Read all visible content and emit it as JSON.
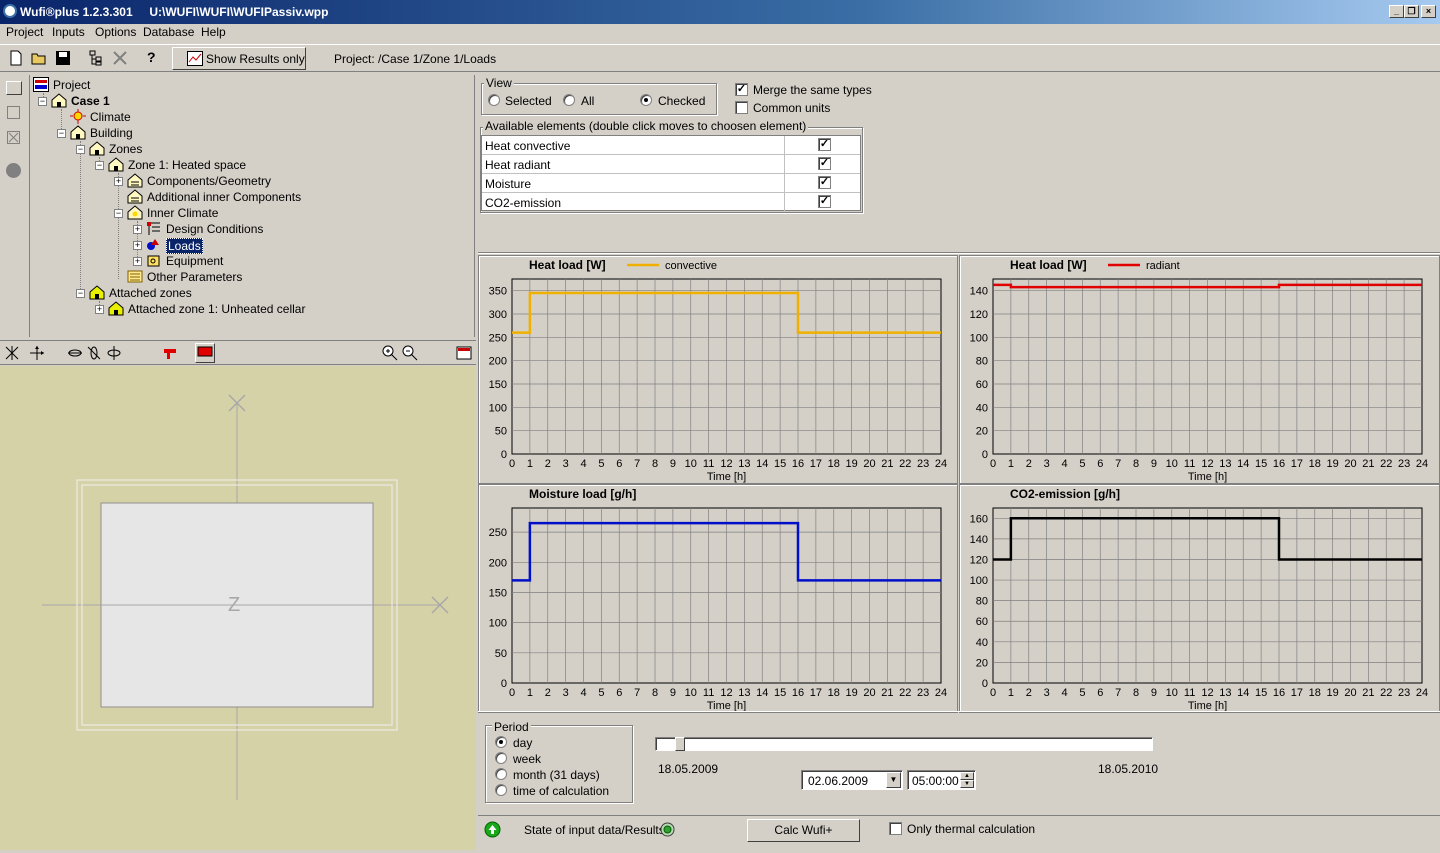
{
  "window": {
    "title": "Wufi®plus 1.2.3.301     U:\\WUFI\\WUFI\\WUFIPassiv.wpp",
    "minimize": "_",
    "restore": "❐",
    "close": "×"
  },
  "menu": [
    "Project",
    "Inputs",
    "Options",
    "Database",
    "Help"
  ],
  "toolbar": {
    "show_results_label": "Show Results only",
    "help_label": "?",
    "project_path": "Project: /Case 1/Zone 1/Loads"
  },
  "tree": {
    "project": "Project",
    "case": "Case 1",
    "climate": "Climate",
    "building": "Building",
    "zones": "Zones",
    "zone1": "Zone 1: Heated space",
    "components": "Components/Geometry",
    "additional": "Additional inner Components",
    "inner_climate": "Inner Climate",
    "design_conditions": "Design Conditions",
    "loads": "Loads",
    "equipment": "Equipment",
    "other": "Other Parameters",
    "attached_zones": "Attached zones",
    "attached_zone1": "Attached zone 1: Unheated cellar"
  },
  "canvas": {
    "z_label": "Z"
  },
  "view": {
    "group_label": "View",
    "options": [
      "Selected",
      "All",
      "Checked"
    ],
    "selected": "Checked",
    "merge_label": "Merge the same types",
    "merge_checked": true,
    "common_units_label": "Common units",
    "common_units_checked": false
  },
  "elements": {
    "group_label": "Available elements (double click moves to choosen element)",
    "rows": [
      {
        "name": "Heat convective",
        "checked": true
      },
      {
        "name": "Heat radiant",
        "checked": true
      },
      {
        "name": "Moisture",
        "checked": true
      },
      {
        "name": "CO2-emission",
        "checked": true
      }
    ]
  },
  "chart_data": [
    {
      "type": "line",
      "title": "Heat load [W]",
      "xlabel": "Time [h]",
      "ylabel": "",
      "xlim": [
        0,
        24
      ],
      "ylim": [
        0,
        375
      ],
      "yticks": [
        0,
        50,
        100,
        150,
        200,
        250,
        300,
        350
      ],
      "grid": true,
      "legend": "top",
      "series": [
        {
          "name": "convective",
          "color": "#f0b000",
          "step": true,
          "x": [
            0,
            1,
            1,
            16,
            16,
            24
          ],
          "y": [
            260,
            260,
            345,
            345,
            260,
            260
          ]
        }
      ]
    },
    {
      "type": "line",
      "title": "Heat load [W]",
      "xlabel": "Time [h]",
      "ylabel": "",
      "xlim": [
        0,
        24
      ],
      "ylim": [
        0,
        150
      ],
      "yticks": [
        0,
        20,
        40,
        60,
        80,
        100,
        120,
        140
      ],
      "grid": true,
      "legend": "top",
      "series": [
        {
          "name": "radiant",
          "color": "#e00000",
          "step": true,
          "x": [
            0,
            1,
            1,
            16,
            16,
            24
          ],
          "y": [
            145,
            145,
            143,
            143,
            145,
            145
          ]
        }
      ]
    },
    {
      "type": "line",
      "title": "Moisture load [g/h]",
      "xlabel": "Time [h]",
      "ylabel": "",
      "xlim": [
        0,
        24
      ],
      "ylim": [
        0,
        290
      ],
      "yticks": [
        0,
        50,
        100,
        150,
        200,
        250
      ],
      "grid": true,
      "legend": "",
      "series": [
        {
          "color": "#0010c8",
          "step": true,
          "x": [
            0,
            1,
            1,
            16,
            16,
            24
          ],
          "y": [
            170,
            170,
            265,
            265,
            170,
            170
          ]
        }
      ]
    },
    {
      "type": "line",
      "title": "CO2-emission [g/h]",
      "xlabel": "Time [h]",
      "ylabel": "",
      "xlim": [
        0,
        24
      ],
      "ylim": [
        0,
        170
      ],
      "yticks": [
        0,
        20,
        40,
        60,
        80,
        100,
        120,
        140,
        160
      ],
      "grid": true,
      "legend": "",
      "series": [
        {
          "color": "#000000",
          "step": true,
          "x": [
            0,
            1,
            1,
            16,
            16,
            24
          ],
          "y": [
            120,
            120,
            160,
            160,
            120,
            120
          ]
        }
      ]
    }
  ],
  "period": {
    "group_label": "Period",
    "options": [
      "day",
      "week",
      "month (31 days)",
      "time of calculation"
    ],
    "selected": "day",
    "start_date": "18.05.2009",
    "end_date": "18.05.2010",
    "slider_fraction": 0.04,
    "date_value": "02.06.2009",
    "time_value": "05:00:00"
  },
  "status": {
    "state_label": "State of input data/Results",
    "calc_button": "Calc Wufi+",
    "thermal_label": "Only thermal calculation",
    "thermal_checked": false
  }
}
